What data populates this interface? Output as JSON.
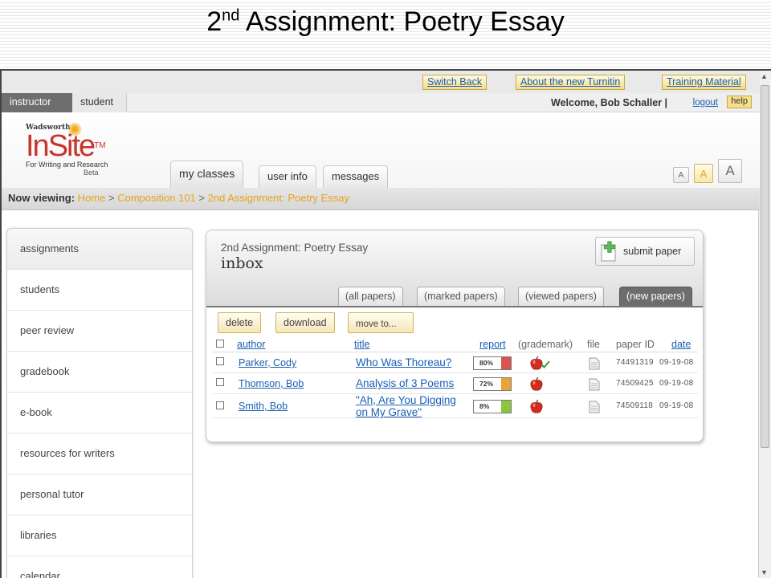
{
  "slide": {
    "title_ordinal": "2",
    "title_suffix": "nd",
    "title_rest": " Assignment: Poetry Essay"
  },
  "topbar": {
    "buttons": [
      "Switch Back",
      "About the new Turnitin",
      "Training Material"
    ]
  },
  "rolebar": {
    "tabs": [
      "instructor",
      "student"
    ],
    "welcome": "Welcome, Bob Schaller |",
    "logout": "logout",
    "help": "help"
  },
  "logo": {
    "publisher": "Wadsworth",
    "name": "InSite",
    "tm": "TM",
    "tagline": "For Writing and Research",
    "beta": "Beta"
  },
  "main_tabs": [
    "my classes",
    "user info",
    "messages"
  ],
  "text_size_buttons": [
    "A",
    "A",
    "A"
  ],
  "breadcrumb": {
    "label": "Now viewing:",
    "items": [
      "Home",
      "Composition 101",
      "2nd Assignment: Poetry Essay"
    ],
    "separator": ">"
  },
  "sidebar": {
    "items": [
      "assignments",
      "students",
      "peer review",
      "gradebook",
      "e-book",
      "resources for writers",
      "personal tutor",
      "libraries",
      "calendar"
    ]
  },
  "inbox": {
    "assignment": "2nd Assignment: Poetry Essay",
    "title": "inbox",
    "submit_label": "submit paper",
    "tabs": [
      "(all papers)",
      "(marked papers)",
      "(viewed papers)",
      "(new papers)"
    ],
    "active_tab": "(new papers)",
    "actions": [
      "delete",
      "download",
      "move to..."
    ],
    "columns": {
      "author": "author",
      "title": "title",
      "report": "report",
      "grademark": "(grademark)",
      "file": "file",
      "paper_id": "paper ID",
      "date": "date"
    },
    "rows": [
      {
        "author": "Parker, Cody",
        "title": "Who Was Thoreau?",
        "report": "80%",
        "report_value": 80,
        "report_color": "#d9534f",
        "graded": true,
        "paper_id": "74491319",
        "date": "09-19-08"
      },
      {
        "author": "Thomson, Bob",
        "title": "Analysis of 3 Poems",
        "report": "72%",
        "report_value": 72,
        "report_color": "#e8a43a",
        "graded": false,
        "paper_id": "74509425",
        "date": "09-19-08"
      },
      {
        "author": "Smith, Bob",
        "title_line1": "\"Ah, Are You Digging",
        "title_line2": "on My Grave\"",
        "report": "8%",
        "report_value": 8,
        "report_color": "#8cc63f",
        "graded": false,
        "paper_id": "74509118",
        "date": "09-19-08"
      }
    ]
  },
  "colors": {
    "link": "#1a5fb4",
    "breadcrumb_link": "#e8a41c",
    "brand_red": "#c8352c",
    "button_gold": "#f3dc8a"
  },
  "icons": {
    "grademark": "apple-icon",
    "graded_mark": "checkmark-icon",
    "file": "document-icon",
    "submit": "plus-icon",
    "logo_mark": "sun-icon",
    "dropdown": "chevron-down-icon"
  }
}
